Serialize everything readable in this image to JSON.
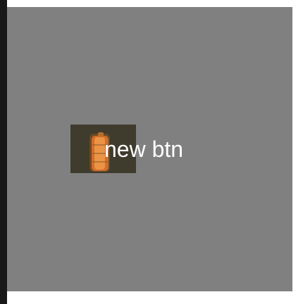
{
  "button": {
    "label": "new btn",
    "image_icon": "battery-icon"
  },
  "colors": {
    "panel": "#808080",
    "left_strip": "#181818",
    "label": "#ffffff",
    "image_background": "#3f3b2d",
    "image_accent": "#e07a2c"
  }
}
